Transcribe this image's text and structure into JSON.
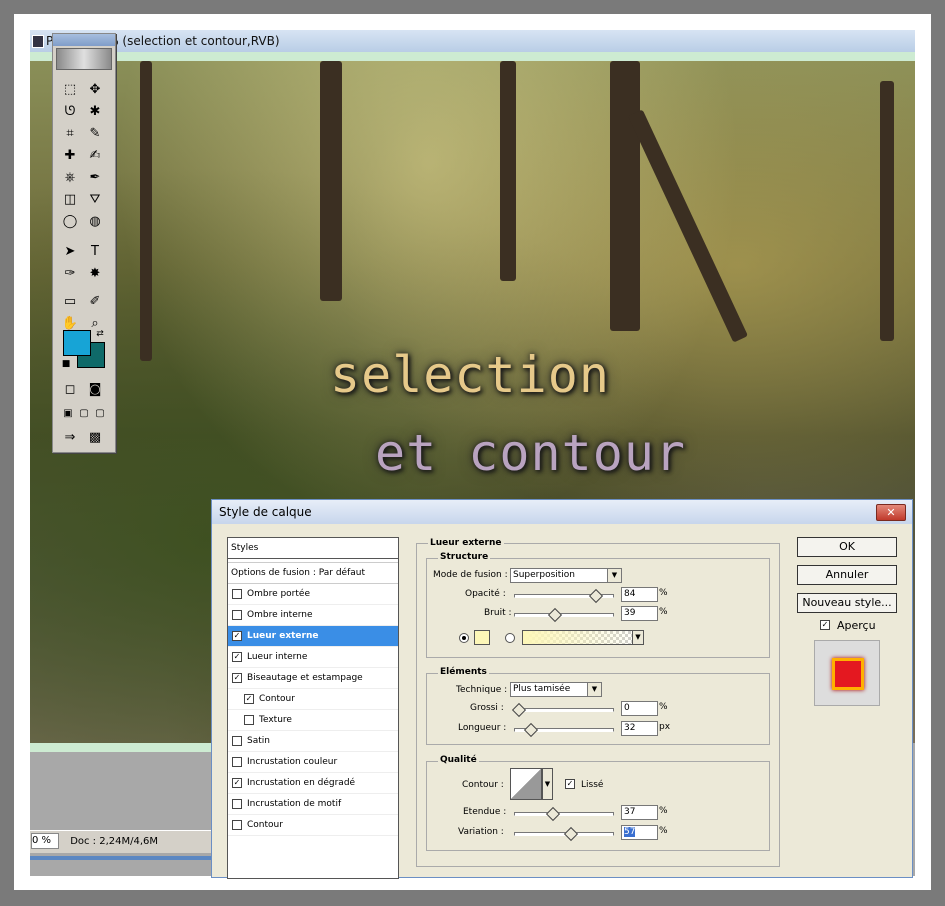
{
  "document": {
    "title": "P         g @ 100% (selection  et contour,RVB)",
    "canvas_text_line1": "selection",
    "canvas_text_line2": "et contour",
    "zoom": "0 %",
    "doc_info": "Doc : 2,24M/4,6M"
  },
  "dialog": {
    "title": "Style de calque",
    "close_label": "✕",
    "styles_header": "Styles",
    "blend_options": "Options de fusion : Par défaut",
    "styles": [
      {
        "label": "Ombre portée",
        "checked": false
      },
      {
        "label": "Ombre interne",
        "checked": false
      },
      {
        "label": "Lueur externe",
        "checked": true,
        "selected": true
      },
      {
        "label": "Lueur interne",
        "checked": true
      },
      {
        "label": "Biseautage et estampage",
        "checked": true
      },
      {
        "label": "Contour",
        "checked": true,
        "sub": true
      },
      {
        "label": "Texture",
        "checked": false,
        "sub": true
      },
      {
        "label": "Satin",
        "checked": false
      },
      {
        "label": "Incrustation couleur",
        "checked": false
      },
      {
        "label": "Incrustation en dégradé",
        "checked": true
      },
      {
        "label": "Incrustation de motif",
        "checked": false
      },
      {
        "label": "Contour",
        "checked": false
      }
    ],
    "panel_title": "Lueur externe",
    "structure": {
      "title": "Structure",
      "mode_label": "Mode de fusion :",
      "mode_value": "Superposition",
      "opacity_label": "Opacité :",
      "opacity_value": "84",
      "opacity_pct": 0.84,
      "noise_label": "Bruit :",
      "noise_value": "39",
      "noise_pct": 0.39,
      "unit_pct": "%"
    },
    "elements": {
      "title": "Eléments",
      "technique_label": "Technique :",
      "technique_value": "Plus tamisée",
      "spread_label": "Grossi :",
      "spread_value": "0",
      "spread_pct": 0,
      "size_label": "Longueur :",
      "size_value": "32",
      "size_pct": 0.13,
      "unit_pct": "%",
      "unit_px": "px"
    },
    "quality": {
      "title": "Qualité",
      "contour_label": "Contour :",
      "smooth_label": "Lissé",
      "range_label": "Etendue :",
      "range_value": "37",
      "range_pct": 0.37,
      "jitter_label": "Variation :",
      "jitter_value": "57",
      "jitter_pct": 0.57,
      "unit_pct": "%"
    },
    "buttons": {
      "ok": "OK",
      "cancel": "Annuler",
      "new_style": "Nouveau style...",
      "preview_label": "Aperçu"
    },
    "colors": {
      "glow": "#fdf7b8",
      "fg_swatch": "#17a4d6",
      "bg_swatch": "#0f6a69"
    }
  },
  "toolbox": {
    "icons": [
      "marquee-icon",
      "move-icon",
      "lasso-icon",
      "magic-wand-icon",
      "crop-icon",
      "slice-icon",
      "healing-icon",
      "brush-icon",
      "stamp-icon",
      "history-brush-icon",
      "eraser-icon",
      "bucket-icon",
      "blur-icon",
      "dodge-icon",
      "path-select-icon",
      "type-icon",
      "pen-icon",
      "shape-icon",
      "notes-icon",
      "eyedropper-icon",
      "hand-icon",
      "zoom-icon"
    ]
  }
}
